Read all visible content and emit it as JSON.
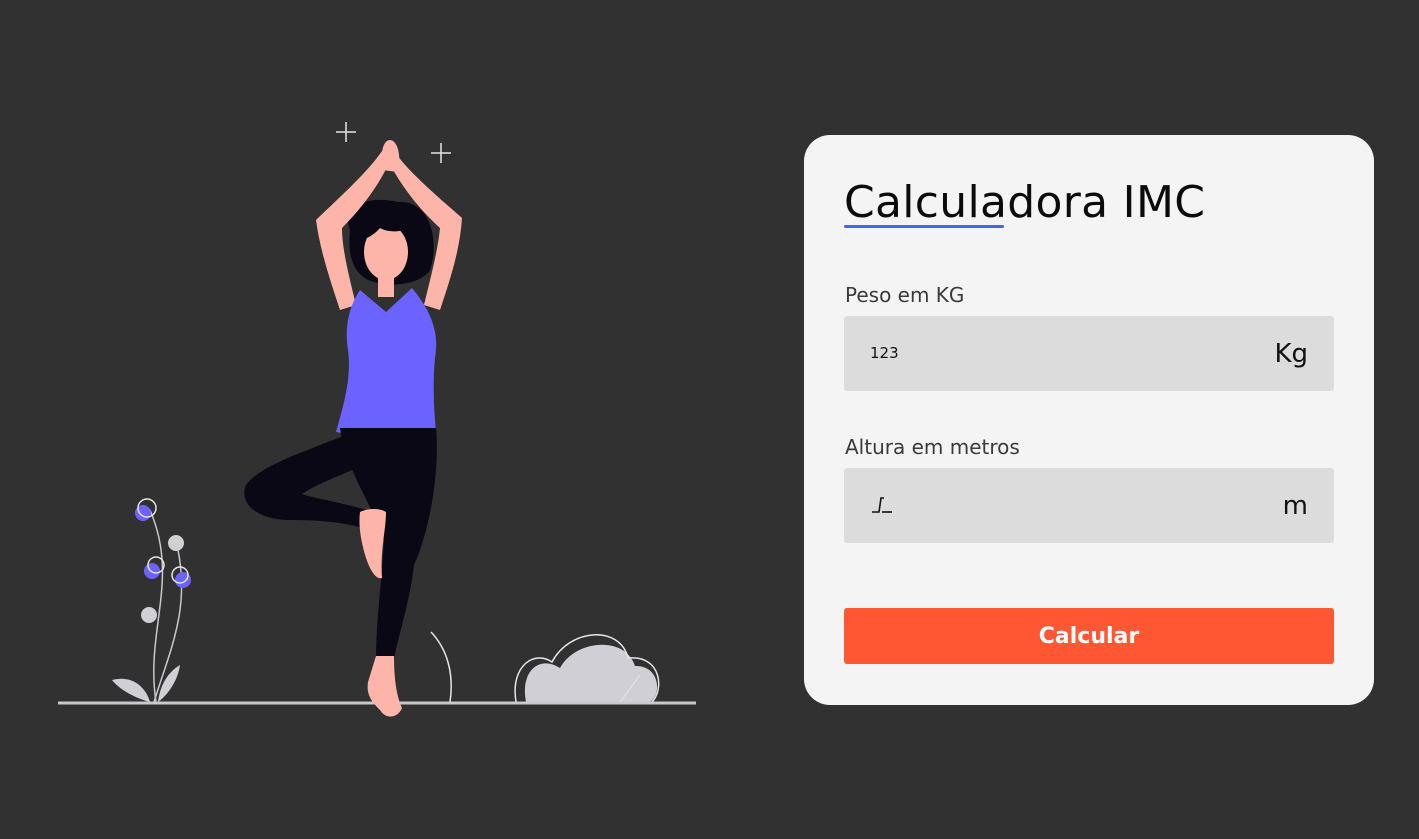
{
  "colors": {
    "background": "#313131",
    "card": "#f4f4f4",
    "accent_underline": "#4b64e6",
    "button": "#ff5733",
    "shirt": "#6c63ff",
    "skin": "#fcb5a8",
    "pants": "#090814"
  },
  "form": {
    "title": "Calculadora IMC",
    "weight": {
      "label": "Peso em KG",
      "icon": "numeric-123-icon",
      "icon_text": "123",
      "value": "",
      "unit": "Kg"
    },
    "height": {
      "label": "Altura em metros",
      "icon": "ruler-step-icon",
      "icon_text": "⎍",
      "value": "",
      "unit": "m"
    },
    "submit_label": "Calcular"
  },
  "illustration": {
    "subject": "woman-yoga-tree-pose"
  }
}
